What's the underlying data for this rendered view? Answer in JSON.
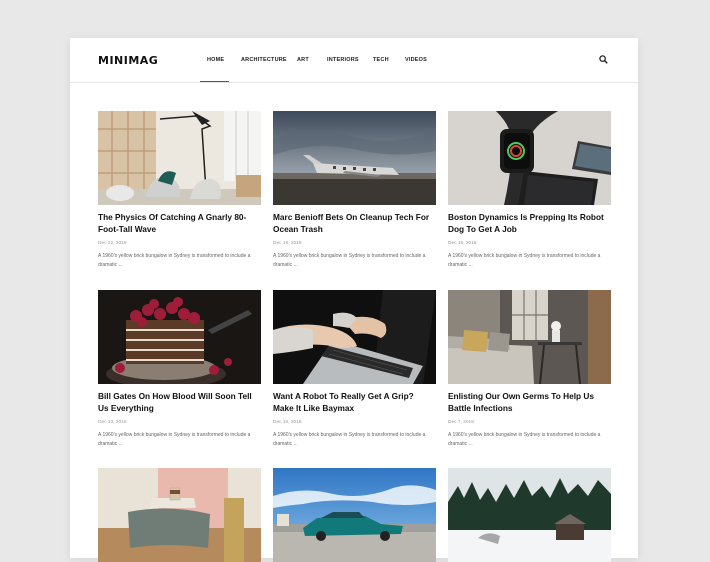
{
  "brand": {
    "logo": "MINIMAG"
  },
  "nav": {
    "items": [
      {
        "label": "HOME",
        "active": true
      },
      {
        "label": "ARCHITECTURE",
        "active": false
      },
      {
        "label": "ART",
        "active": false
      },
      {
        "label": "INTERIORS",
        "active": false
      },
      {
        "label": "TECH",
        "active": false
      },
      {
        "label": "VIDEOS",
        "active": false
      }
    ],
    "search_icon": "search-icon"
  },
  "posts": [
    {
      "title": "The Physics Of Catching A Gnarly 80-Foot-Tall Wave",
      "date": "Dec 22, 2018",
      "excerpt": "A 1960's yellow brick bungalow in Sydney is transformed to include a dramatic ...",
      "image": "modern-interior-chairs"
    },
    {
      "title": "Marc Benioff Bets On Cleanup Tech For Ocean Trash",
      "date": "Dec 19, 2018",
      "excerpt": "A 1960's yellow brick bungalow in Sydney is transformed to include a dramatic ...",
      "image": "plane-wreck"
    },
    {
      "title": "Boston Dynamics Is Prepping Its Robot Dog To Get A Job",
      "date": "Dec 16, 2018",
      "excerpt": "A 1960's yellow brick bungalow in Sydney is transformed to include a dramatic ...",
      "image": "smartwatch-phones"
    },
    {
      "title": "Bill Gates On How Blood Will Soon Tell Us Everything",
      "date": "Dec 13, 2018",
      "excerpt": "A 1960's yellow brick bungalow in Sydney is transformed to include a dramatic ...",
      "image": "raspberry-cake"
    },
    {
      "title": "Want A Robot To Really Get A Grip? Make It Like Baymax",
      "date": "Dec 10, 2018",
      "excerpt": "A 1960's yellow brick bungalow in Sydney is transformed to include a dramatic ...",
      "image": "hands-laptop"
    },
    {
      "title": "Enlisting Our Own Germs To Help Us Battle Infections",
      "date": "Dec 7, 2018",
      "excerpt": "A 1960's yellow brick bungalow in Sydney is transformed to include a dramatic ...",
      "image": "cozy-living-room"
    },
    {
      "title": "",
      "date": "",
      "excerpt": "",
      "image": "table-towel-coffee"
    },
    {
      "title": "",
      "date": "",
      "excerpt": "",
      "image": "vintage-car-sky"
    },
    {
      "title": "",
      "date": "",
      "excerpt": "",
      "image": "snowy-forest-cabin"
    }
  ]
}
